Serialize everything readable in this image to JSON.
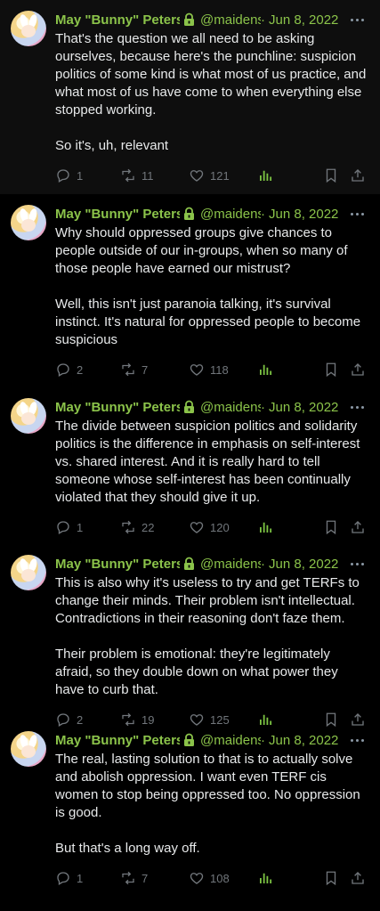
{
  "colors": {
    "name": "#8bc34a",
    "muted": "#71767b",
    "views": "#7cc443",
    "background": "#000000"
  },
  "tweets": [
    {
      "name": "May \"Bunny\" Peters",
      "handle": "@maidens",
      "date": "Jun 8, 2022",
      "text": "That's the question we all need to be asking ourselves, because here's the punchline: suspicion politics of some kind is what most of us practice, and what most of us have come to when everything else stopped working.\n\nSo it's, uh, relevant",
      "replies": "1",
      "retweets": "11",
      "likes": "121"
    },
    {
      "name": "May \"Bunny\" Peters",
      "handle": "@maidens",
      "date": "Jun 8, 2022",
      "text": "Why should oppressed groups give chances to people outside of our in-groups, when so many of those people have earned our mistrust?\n\nWell, this isn't just paranoia talking, it's survival instinct. It's natural for oppressed people to become suspicious",
      "replies": "2",
      "retweets": "7",
      "likes": "118"
    },
    {
      "name": "May \"Bunny\" Peters",
      "handle": "@maidens",
      "date": "Jun 8, 2022",
      "text": "The divide between suspicion politics and solidarity politics is the difference in emphasis on self-interest vs. shared interest. And it is really hard to tell someone whose self-interest has been continually violated that they should give it up.",
      "replies": "1",
      "retweets": "22",
      "likes": "120"
    },
    {
      "name": "May \"Bunny\" Peters",
      "handle": "@maidens",
      "date": "Jun 8, 2022",
      "text": "This is also why it's useless to try and get TERFs to change their minds. Their problem isn't intellectual. Contradictions in their reasoning don't faze them.\n\nTheir problem is emotional: they're legitimately afraid, so they double down on what power they have to curb that.",
      "replies": "2",
      "retweets": "19",
      "likes": "125"
    },
    {
      "name": "May \"Bunny\" Peters",
      "handle": "@maidens",
      "date": "Jun 8, 2022",
      "text": "The real, lasting solution to that is to actually solve and abolish oppression. I want even TERF cis women to stop being oppressed too. No oppression is good.\n\nBut that's a long way off.",
      "replies": "1",
      "retweets": "7",
      "likes": "108"
    }
  ]
}
